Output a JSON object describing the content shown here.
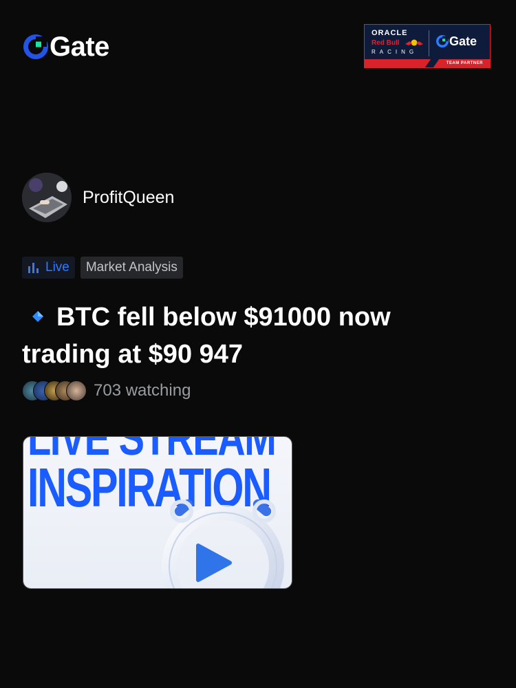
{
  "header": {
    "brand_name": "Gate",
    "partner": {
      "oracle": "ORACLE",
      "red_bull": "Red Bull",
      "racing": "RACING",
      "gate": "Gate",
      "strip": "TEAM PARTNER"
    }
  },
  "author": {
    "name": "ProfitQueen"
  },
  "tags": [
    {
      "label": "Live",
      "icon": "bar-chart-icon",
      "color": "#2f7bff"
    },
    {
      "label": "Market Analysis"
    }
  ],
  "post": {
    "title": "BTC fell below $91000 now trading at $90 947",
    "bullet_icon": "blue-diamond-icon"
  },
  "watchers": {
    "count_text": "703 watching"
  },
  "thumbnail": {
    "line1": "LIVE STREAM",
    "line2": "INSPIRATION",
    "play_icon": "play-icon"
  },
  "colors": {
    "background": "#0a0a0a",
    "accent": "#2f7bff",
    "brand_blue": "#1a5cff",
    "partner_red": "#d8232a",
    "partner_navy": "#0e1b3a"
  }
}
